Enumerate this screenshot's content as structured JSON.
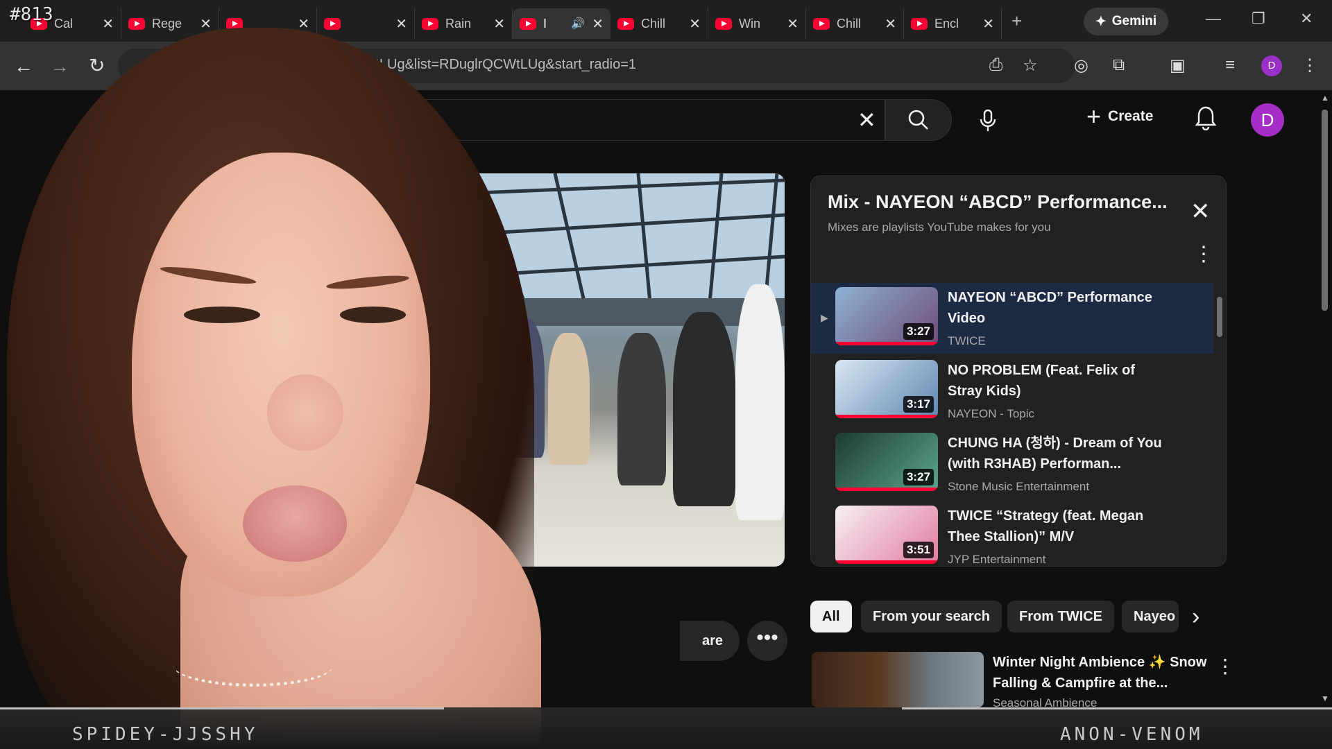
{
  "stream": {
    "number": "#813",
    "left_name": "SPIDEY-JJSSHY",
    "right_name": "ANON-VENOM"
  },
  "browser": {
    "tabs": [
      {
        "title": "Cal"
      },
      {
        "title": "Rege"
      },
      {
        "title": ""
      },
      {
        "title": ""
      },
      {
        "title": "Rain"
      },
      {
        "title": "I",
        "active": true
      },
      {
        "title": "Chill"
      },
      {
        "title": "Win"
      },
      {
        "title": "Chill"
      },
      {
        "title": "Encl"
      }
    ],
    "gemini_label": "Gemini",
    "url": "CWtLUg&list=RDuglrQCWtLUg&start_radio=1",
    "profile_initial": "D"
  },
  "youtube": {
    "create_label": "Create",
    "avatar_initial": "D",
    "share_label": "are",
    "mix": {
      "title": "Mix - NAYEON “ABCD” Performance...",
      "subtitle": "Mixes are playlists YouTube makes for you",
      "items": [
        {
          "title": "NAYEON “ABCD” Performance Video",
          "channel": "TWICE",
          "duration": "3:27",
          "active": true,
          "thumb_colors": [
            "#8fb2d4",
            "#6e4a7a"
          ]
        },
        {
          "title": "NO PROBLEM (Feat. Felix of Stray Kids)",
          "channel": "NAYEON - Topic",
          "duration": "3:17",
          "active": false,
          "thumb_colors": [
            "#d9e7f3",
            "#5e85b0"
          ]
        },
        {
          "title": "CHUNG HA (청하) - Dream of You (with R3HAB) Performan...",
          "channel": "Stone Music Entertainment",
          "duration": "3:27",
          "active": false,
          "thumb_colors": [
            "#1e3b33",
            "#5aa58e"
          ]
        },
        {
          "title": "TWICE “Strategy (feat. Megan Thee Stallion)” M/V",
          "channel": "JYP Entertainment",
          "duration": "3:51",
          "active": false,
          "thumb_colors": [
            "#f6f1f4",
            "#e27aa3"
          ]
        }
      ]
    },
    "chips": [
      "All",
      "From your search",
      "From TWICE",
      "Nayeo"
    ],
    "recommended": {
      "title": "Winter Night Ambience ✨ Snow Falling & Campfire at the...",
      "channel": "Seasonal Ambience"
    }
  }
}
